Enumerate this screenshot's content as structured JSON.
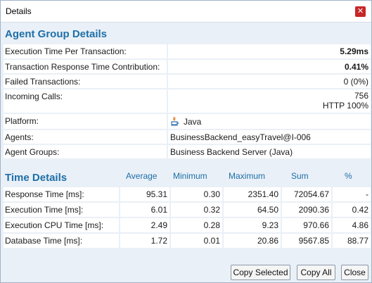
{
  "window": {
    "title": "Details"
  },
  "agent_group": {
    "title": "Agent Group Details",
    "rows": [
      {
        "label": "Execution Time Per Transaction:",
        "value": "5.29ms"
      },
      {
        "label": "Transaction Response Time Contribution:",
        "value": "0.41%"
      },
      {
        "label": "Failed Transactions:",
        "value": "0 (0%)"
      },
      {
        "label": "Incoming Calls:",
        "value_line1": "756",
        "value_line2": "HTTP 100%"
      },
      {
        "label": "Platform:",
        "value": "Java"
      },
      {
        "label": "Agents:",
        "value": "BusinessBackend_easyTravel@I-006"
      },
      {
        "label": "Agent Groups:",
        "value": "Business Backend Server (Java)"
      }
    ]
  },
  "time_details": {
    "title": "Time Details",
    "columns": [
      "Average",
      "Minimum",
      "Maximum",
      "Sum",
      "%"
    ],
    "rows": [
      {
        "label": "Response Time [ms]:",
        "cells": [
          "95.31",
          "0.30",
          "2351.40",
          "72054.67",
          "-"
        ]
      },
      {
        "label": "Execution Time [ms]:",
        "cells": [
          "6.01",
          "0.32",
          "64.50",
          "2090.36",
          "0.42"
        ]
      },
      {
        "label": "Execution CPU Time [ms]:",
        "cells": [
          "2.49",
          "0.28",
          "9.23",
          "970.66",
          "4.86"
        ]
      },
      {
        "label": "Database Time [ms]:",
        "cells": [
          "1.72",
          "0.01",
          "20.86",
          "9567.85",
          "88.77"
        ]
      }
    ]
  },
  "buttons": {
    "copy_selected": "Copy Selected",
    "copy_all": "Copy All",
    "close": "Close"
  },
  "icons": {
    "close": "close-icon",
    "platform": "java-icon"
  },
  "colors": {
    "accent": "#1d6fa8",
    "close_button": "#c62828",
    "background": "#eaf0f7"
  }
}
